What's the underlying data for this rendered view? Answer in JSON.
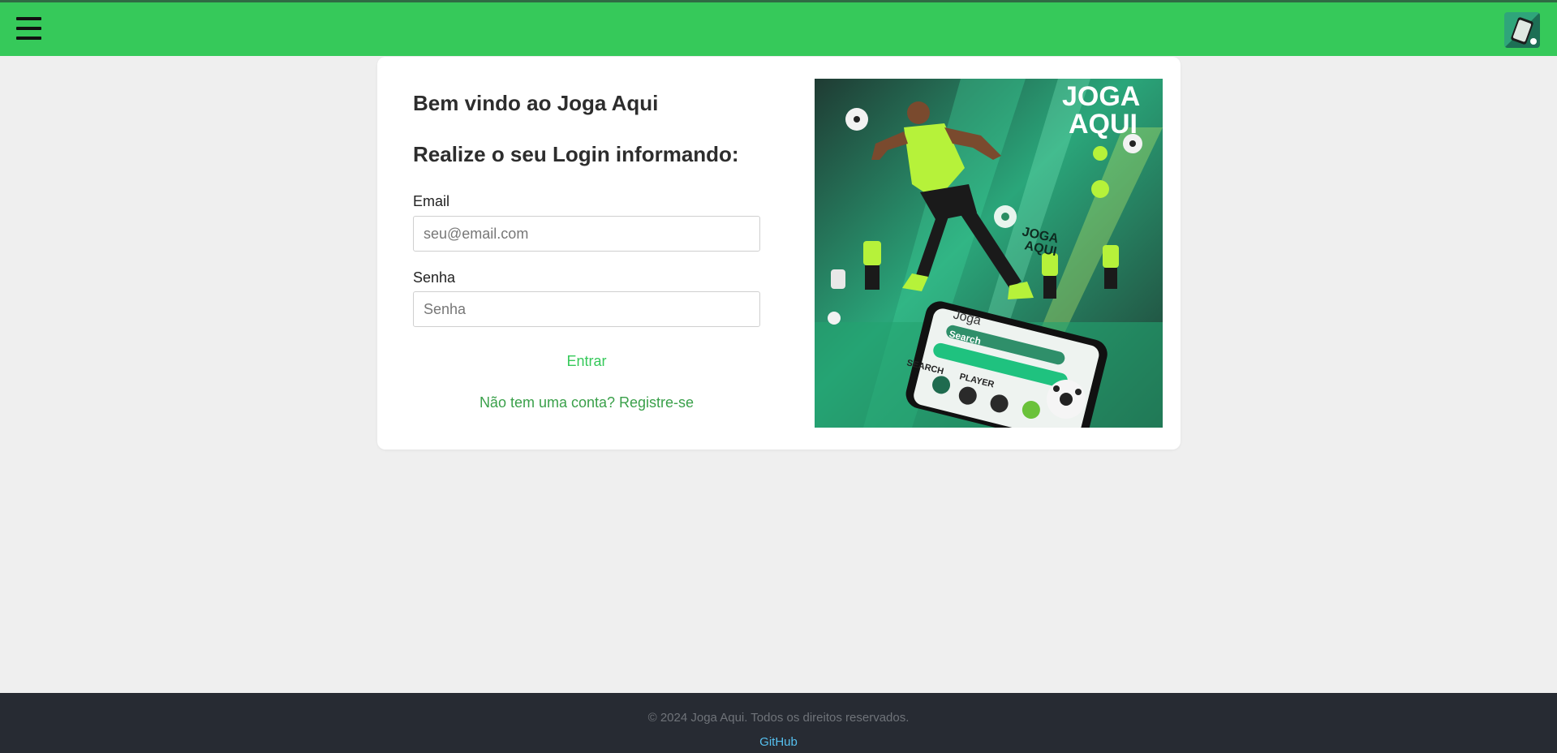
{
  "colors": {
    "navbar": "#36c95a",
    "accent": "#36c95a",
    "link": "#3aa04a",
    "footer": "#272b33",
    "background": "#efefef"
  },
  "icons": {
    "menu": "hamburger-icon",
    "avatar": "joga-aqui-logo"
  },
  "login": {
    "welcome": "Bem vindo ao Joga Aqui",
    "subtitle": "Realize o seu Login informando:",
    "email_label": "Email",
    "email_placeholder": "seu@email.com",
    "email_value": "",
    "password_label": "Senha",
    "password_placeholder": "Senha",
    "password_value": "",
    "submit_label": "Entrar",
    "register_link": "Não tem uma conta? Registre-se"
  },
  "hero": {
    "logo_text_line1": "JOGA",
    "logo_text_line2": "AQUI",
    "phone_words": [
      "Joga",
      "Search",
      "SEARCH",
      "PLAYER"
    ]
  },
  "footer": {
    "copyright": "© 2024 Joga Aqui. Todos os direitos reservados.",
    "github_label": "GitHub"
  }
}
